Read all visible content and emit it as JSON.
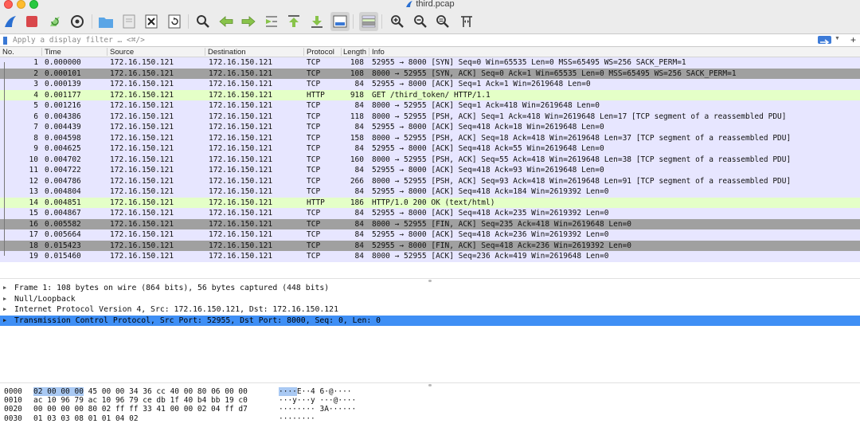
{
  "window": {
    "title": "third.pcap"
  },
  "toolbar": {
    "buttons": [
      {
        "name": "start-capture-fin-icon"
      },
      {
        "name": "stop-capture-icon"
      },
      {
        "name": "restart-capture-icon"
      },
      {
        "name": "capture-options-icon"
      },
      {
        "name": "open-file-icon"
      },
      {
        "name": "save-file-icon"
      },
      {
        "name": "close-file-icon"
      },
      {
        "name": "reload-file-icon"
      },
      {
        "name": "find-packet-icon"
      },
      {
        "name": "go-back-icon"
      },
      {
        "name": "go-forward-icon"
      },
      {
        "name": "go-to-packet-icon"
      },
      {
        "name": "go-first-packet-icon"
      },
      {
        "name": "go-last-packet-icon"
      },
      {
        "name": "autoscroll-icon"
      },
      {
        "name": "colorize-icon"
      },
      {
        "name": "zoom-in-icon"
      },
      {
        "name": "zoom-out-icon"
      },
      {
        "name": "zoom-normal-icon"
      },
      {
        "name": "resize-columns-icon"
      }
    ]
  },
  "filter": {
    "placeholder": "Apply a display filter … <⌘/>",
    "value": "",
    "plus_label": "+"
  },
  "packet_list": {
    "columns": [
      "No.",
      "Time",
      "Source",
      "Destination",
      "Protocol",
      "Length",
      "Info"
    ],
    "rows": [
      {
        "no": "1",
        "time": "0.000000",
        "src": "172.16.150.121",
        "dst": "172.16.150.121",
        "proto": "TCP",
        "len": "108",
        "info": "52955 → 8000 [SYN] Seq=0 Win=65535 Len=0 MSS=65495 WS=256 SACK_PERM=1",
        "color": "#e7e6ff"
      },
      {
        "no": "2",
        "time": "0.000101",
        "src": "172.16.150.121",
        "dst": "172.16.150.121",
        "proto": "TCP",
        "len": "108",
        "info": "8000 → 52955 [SYN, ACK] Seq=0 Ack=1 Win=65535 Len=0 MSS=65495 WS=256 SACK_PERM=1",
        "color": "#a0a0a0"
      },
      {
        "no": "3",
        "time": "0.000139",
        "src": "172.16.150.121",
        "dst": "172.16.150.121",
        "proto": "TCP",
        "len": "84",
        "info": "52955 → 8000 [ACK] Seq=1 Ack=1 Win=2619648 Len=0",
        "color": "#e7e6ff"
      },
      {
        "no": "4",
        "time": "0.001177",
        "src": "172.16.150.121",
        "dst": "172.16.150.121",
        "proto": "HTTP",
        "len": "918",
        "info": "GET /third_token/ HTTP/1.1",
        "color": "#e4ffc7"
      },
      {
        "no": "5",
        "time": "0.001216",
        "src": "172.16.150.121",
        "dst": "172.16.150.121",
        "proto": "TCP",
        "len": "84",
        "info": "8000 → 52955 [ACK] Seq=1 Ack=418 Win=2619648 Len=0",
        "color": "#e7e6ff"
      },
      {
        "no": "6",
        "time": "0.004386",
        "src": "172.16.150.121",
        "dst": "172.16.150.121",
        "proto": "TCP",
        "len": "118",
        "info": "8000 → 52955 [PSH, ACK] Seq=1 Ack=418 Win=2619648 Len=17 [TCP segment of a reassembled PDU]",
        "color": "#e7e6ff"
      },
      {
        "no": "7",
        "time": "0.004439",
        "src": "172.16.150.121",
        "dst": "172.16.150.121",
        "proto": "TCP",
        "len": "84",
        "info": "52955 → 8000 [ACK] Seq=418 Ack=18 Win=2619648 Len=0",
        "color": "#e7e6ff"
      },
      {
        "no": "8",
        "time": "0.004598",
        "src": "172.16.150.121",
        "dst": "172.16.150.121",
        "proto": "TCP",
        "len": "158",
        "info": "8000 → 52955 [PSH, ACK] Seq=18 Ack=418 Win=2619648 Len=37 [TCP segment of a reassembled PDU]",
        "color": "#e7e6ff"
      },
      {
        "no": "9",
        "time": "0.004625",
        "src": "172.16.150.121",
        "dst": "172.16.150.121",
        "proto": "TCP",
        "len": "84",
        "info": "52955 → 8000 [ACK] Seq=418 Ack=55 Win=2619648 Len=0",
        "color": "#e7e6ff"
      },
      {
        "no": "10",
        "time": "0.004702",
        "src": "172.16.150.121",
        "dst": "172.16.150.121",
        "proto": "TCP",
        "len": "160",
        "info": "8000 → 52955 [PSH, ACK] Seq=55 Ack=418 Win=2619648 Len=38 [TCP segment of a reassembled PDU]",
        "color": "#e7e6ff"
      },
      {
        "no": "11",
        "time": "0.004722",
        "src": "172.16.150.121",
        "dst": "172.16.150.121",
        "proto": "TCP",
        "len": "84",
        "info": "52955 → 8000 [ACK] Seq=418 Ack=93 Win=2619648 Len=0",
        "color": "#e7e6ff"
      },
      {
        "no": "12",
        "time": "0.004786",
        "src": "172.16.150.121",
        "dst": "172.16.150.121",
        "proto": "TCP",
        "len": "266",
        "info": "8000 → 52955 [PSH, ACK] Seq=93 Ack=418 Win=2619648 Len=91 [TCP segment of a reassembled PDU]",
        "color": "#e7e6ff"
      },
      {
        "no": "13",
        "time": "0.004804",
        "src": "172.16.150.121",
        "dst": "172.16.150.121",
        "proto": "TCP",
        "len": "84",
        "info": "52955 → 8000 [ACK] Seq=418 Ack=184 Win=2619392 Len=0",
        "color": "#e7e6ff"
      },
      {
        "no": "14",
        "time": "0.004851",
        "src": "172.16.150.121",
        "dst": "172.16.150.121",
        "proto": "HTTP",
        "len": "186",
        "info": "HTTP/1.0 200 OK  (text/html)",
        "color": "#e4ffc7"
      },
      {
        "no": "15",
        "time": "0.004867",
        "src": "172.16.150.121",
        "dst": "172.16.150.121",
        "proto": "TCP",
        "len": "84",
        "info": "52955 → 8000 [ACK] Seq=418 Ack=235 Win=2619392 Len=0",
        "color": "#e7e6ff"
      },
      {
        "no": "16",
        "time": "0.005582",
        "src": "172.16.150.121",
        "dst": "172.16.150.121",
        "proto": "TCP",
        "len": "84",
        "info": "8000 → 52955 [FIN, ACK] Seq=235 Ack=418 Win=2619648 Len=0",
        "color": "#a0a0a0"
      },
      {
        "no": "17",
        "time": "0.005664",
        "src": "172.16.150.121",
        "dst": "172.16.150.121",
        "proto": "TCP",
        "len": "84",
        "info": "52955 → 8000 [ACK] Seq=418 Ack=236 Win=2619392 Len=0",
        "color": "#e7e6ff"
      },
      {
        "no": "18",
        "time": "0.015423",
        "src": "172.16.150.121",
        "dst": "172.16.150.121",
        "proto": "TCP",
        "len": "84",
        "info": "52955 → 8000 [FIN, ACK] Seq=418 Ack=236 Win=2619392 Len=0",
        "color": "#a0a0a0"
      },
      {
        "no": "19",
        "time": "0.015460",
        "src": "172.16.150.121",
        "dst": "172.16.150.121",
        "proto": "TCP",
        "len": "84",
        "info": "8000 → 52955 [ACK] Seq=236 Ack=419 Win=2619648 Len=0",
        "color": "#e7e6ff"
      }
    ]
  },
  "details": {
    "rows": [
      {
        "label": "Frame 1: 108 bytes on wire (864 bits), 56 bytes captured (448 bits)",
        "selected": false
      },
      {
        "label": "Null/Loopback",
        "selected": false
      },
      {
        "label": "Internet Protocol Version 4, Src: 172.16.150.121, Dst: 172.16.150.121",
        "selected": false
      },
      {
        "label": "Transmission Control Protocol, Src Port: 52955, Dst Port: 8000, Seq: 0, Len: 0",
        "selected": true
      }
    ]
  },
  "hex": {
    "rows": [
      {
        "offset": "0000",
        "hex_hl": "02 00 00 00",
        "hex_rest": " 45 00 00 34  36 cc 40 00 80 06 00 00",
        "ascii_hl": "····",
        "ascii_rest": "E··4 6·@····"
      },
      {
        "offset": "0010",
        "hex_hl": "",
        "hex_rest": "ac 10 96 79 ac 10 96 79  ce db 1f 40 b4 bb 19 c0",
        "ascii_hl": "",
        "ascii_rest": "···y···y ···@····"
      },
      {
        "offset": "0020",
        "hex_hl": "",
        "hex_rest": "00 00 00 00 80 02 ff ff  33 41 00 00 02 04 ff d7",
        "ascii_hl": "",
        "ascii_rest": "········ 3A······"
      },
      {
        "offset": "0030",
        "hex_hl": "",
        "hex_rest": "01 03 03 08 01 01 04 02",
        "ascii_hl": "",
        "ascii_rest": "········"
      }
    ]
  },
  "colors": {
    "tcp_row": "#e7e6ff",
    "http_row": "#e4ffc7",
    "syn_fin_row": "#a0a0a0",
    "selection": "#3f8ff5",
    "hex_highlight": "#a9c9f3",
    "accent_blue": "#3a78d4"
  }
}
